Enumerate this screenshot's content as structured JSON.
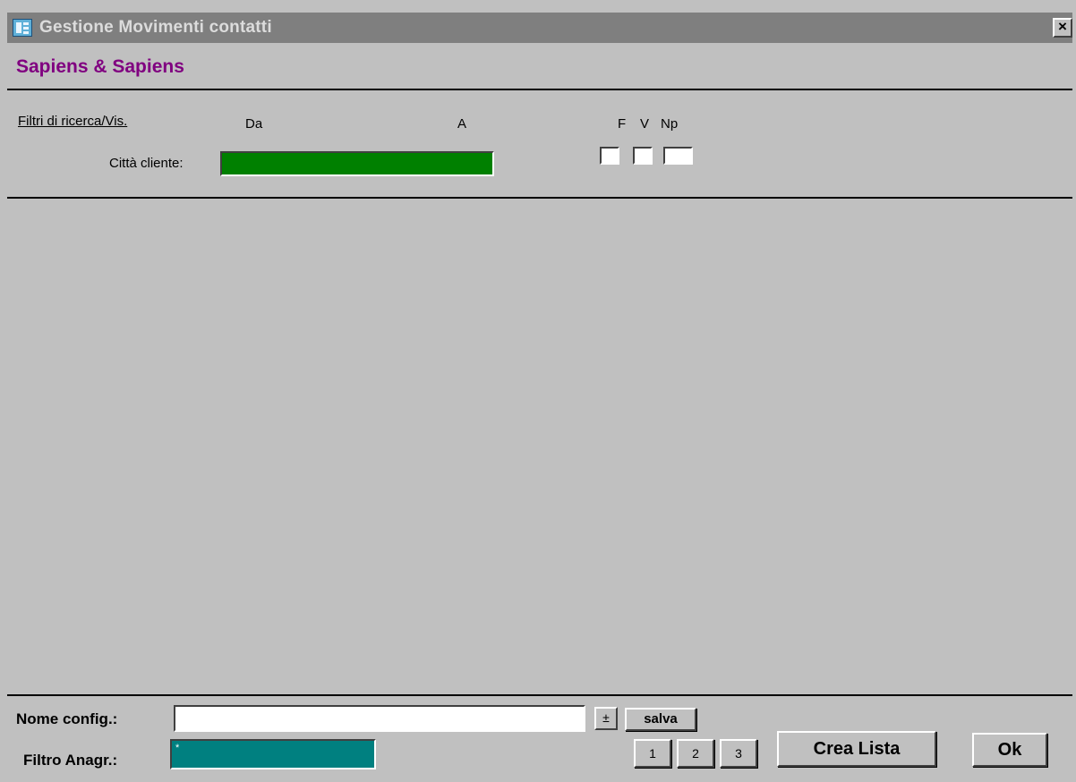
{
  "window": {
    "title": "Gestione Movimenti contatti",
    "close_label": "×"
  },
  "header": {
    "company": "Sapiens & Sapiens"
  },
  "filters": {
    "section_label": "Filtri di ricerca/Vis.",
    "col_from": "Da",
    "col_to": "A",
    "flag_f": "F",
    "flag_v": "V",
    "flag_np": "Np",
    "city_label": "Città cliente:",
    "city_value": ""
  },
  "bottom": {
    "config_label": "Nome config.:",
    "config_value": "",
    "dropdown_icon": "±",
    "save_label": "salva",
    "filter_label": "Filtro Anagr.:",
    "filter_value": "*",
    "page_1": "1",
    "page_2": "2",
    "page_3": "3",
    "create_list_label": "Crea Lista",
    "ok_label": "Ok"
  },
  "colors": {
    "title_bar": "#7f7f7f",
    "company_text": "#800080",
    "city_field": "#008000",
    "filter_field": "#008080",
    "background": "#c0c0c0"
  }
}
